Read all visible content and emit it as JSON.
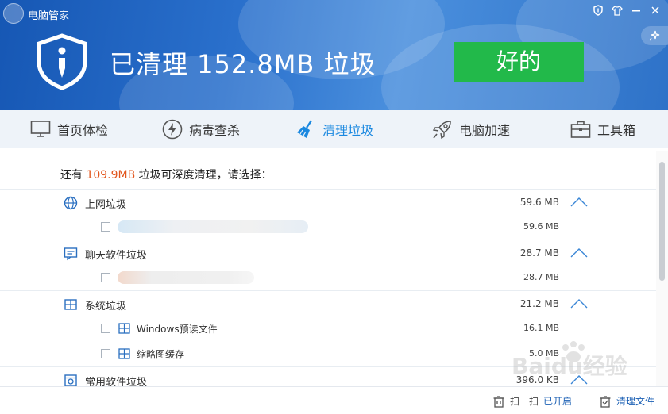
{
  "window": {
    "title": "电脑管家",
    "controls": [
      "shield-icon",
      "shirt-icon",
      "minimize-icon",
      "close-icon"
    ],
    "side_tab_icon": "sparkle-icon"
  },
  "header": {
    "headline": "已清理 152.8MB 垃圾",
    "ok_button": "好的",
    "colors": {
      "header_blue": "#2a70cc",
      "ok_green": "#22b94a"
    }
  },
  "nav": {
    "items": [
      {
        "label": "首页体检",
        "icon": "monitor-icon",
        "active": false
      },
      {
        "label": "病毒查杀",
        "icon": "lightning-icon",
        "active": false
      },
      {
        "label": "清理垃圾",
        "icon": "broom-icon",
        "active": true
      },
      {
        "label": "电脑加速",
        "icon": "rocket-icon",
        "active": false
      },
      {
        "label": "工具箱",
        "icon": "toolbox-icon",
        "active": false
      }
    ],
    "active_color": "#1a88e0"
  },
  "summary": {
    "prefix": "还有",
    "amount": "109.9MB",
    "suffix": "垃圾可深度清理，请选择："
  },
  "categories": [
    {
      "label": "上网垃圾",
      "size": "59.6 MB",
      "icon": "globe-icon",
      "items": [
        {
          "label": "",
          "size": "59.6 MB",
          "blurred": true
        }
      ]
    },
    {
      "label": "聊天软件垃圾",
      "size": "28.7 MB",
      "icon": "chat-icon",
      "items": [
        {
          "label": "",
          "size": "28.7 MB",
          "blurred": true
        }
      ]
    },
    {
      "label": "系统垃圾",
      "size": "21.2 MB",
      "icon": "windows-icon",
      "items": [
        {
          "label": "Windows预读文件",
          "size": "16.1 MB",
          "blurred": false
        },
        {
          "label": "缩略图缓存",
          "size": "5.0 MB",
          "blurred": false
        }
      ]
    },
    {
      "label": "常用软件垃圾",
      "size": "396.0 KB",
      "icon": "software-icon",
      "items": []
    }
  ],
  "footer": {
    "scan_prefix": "扫一扫",
    "scan_status": "已开启",
    "clean_files": "清理文件"
  },
  "watermark": "Baidu经验"
}
